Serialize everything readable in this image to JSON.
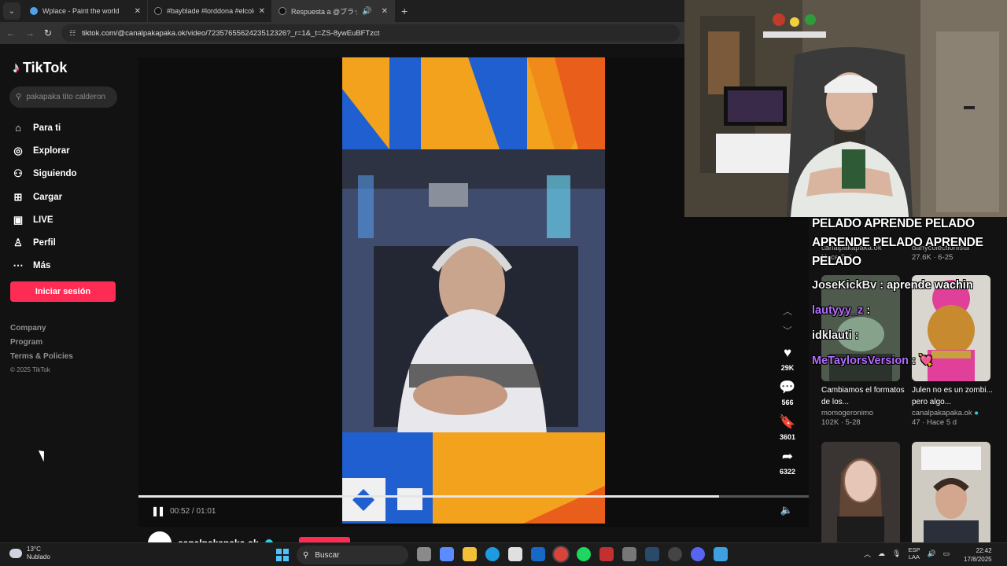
{
  "browser": {
    "tabs": [
      {
        "title": "Wplace - Paint the world",
        "active": false
      },
      {
        "title": "#bayblade #lorddona #elcoleccionista",
        "active": false
      },
      {
        "title": "Respuesta a @ブラッド・ムーン",
        "active": true
      }
    ],
    "url": "tiktok.com/@canalpakapaka.ok/video/7235765562423512326?_r=1&_t=ZS-8ywEuBFTzct"
  },
  "sidebar": {
    "brand": "TikTok",
    "search_placeholder": "pakapaka tito calderon",
    "items": [
      {
        "label": "Para ti",
        "icon": "home-icon"
      },
      {
        "label": "Explorar",
        "icon": "compass-icon"
      },
      {
        "label": "Siguiendo",
        "icon": "following-icon"
      },
      {
        "label": "Cargar",
        "icon": "upload-icon"
      },
      {
        "label": "LIVE",
        "icon": "live-icon"
      },
      {
        "label": "Perfil",
        "icon": "profile-icon"
      },
      {
        "label": "Más",
        "icon": "more-icon"
      }
    ],
    "login_label": "Iniciar sesión",
    "footer_links": [
      "Company",
      "Program",
      "Terms & Policies"
    ],
    "copyright": "© 2025 TikTok"
  },
  "player": {
    "time": "00:52 / 01:01",
    "progress": 0.866,
    "author": "canalpakapaka.ok",
    "actions": [
      {
        "name": "like",
        "icon": "heart-icon",
        "count": "29K"
      },
      {
        "name": "comment",
        "icon": "comment-icon",
        "count": "566"
      },
      {
        "name": "save",
        "icon": "bookmark-icon",
        "count": "3601"
      },
      {
        "name": "share",
        "icon": "share-icon",
        "count": "6322"
      }
    ]
  },
  "related": {
    "row0": [
      {
        "meta": "canalpakapaka.ok",
        "stat": "Hace 3 d"
      },
      {
        "meta": "danycolectionista",
        "stat": "27.6K · 6-25"
      }
    ],
    "row1": [
      {
        "caption": "Cambiamos el formatos de los...",
        "author": "momogeronimo",
        "stat": "102K · 5-28"
      },
      {
        "caption": "Julen no es un zombi... pero algo...",
        "author": "canalpakapaka.ok",
        "stat": "47 · Hace 5 d"
      }
    ]
  },
  "chat": {
    "banner": "PELADO APRENDE PELADO APRENDE PELADO APRENDE PELADO",
    "messages": [
      {
        "user": "JoseKickBv",
        "text": "aprende wachin"
      },
      {
        "user": "lautyyy_z",
        "text": ""
      },
      {
        "user": "idklauti",
        "text": ""
      },
      {
        "user": "MeTaylorsVersion",
        "text": "💘"
      }
    ]
  },
  "taskbar": {
    "temp": "13°C",
    "weather": "Nublado",
    "search_label": "Buscar",
    "lang_top": "ESP",
    "lang_bottom": "LAA",
    "time": "22:42",
    "date": "17/8/2025"
  },
  "colors": {
    "accent": "#fe2c55",
    "teal": "#25f4ee",
    "chat_purple": "#b46cff"
  }
}
